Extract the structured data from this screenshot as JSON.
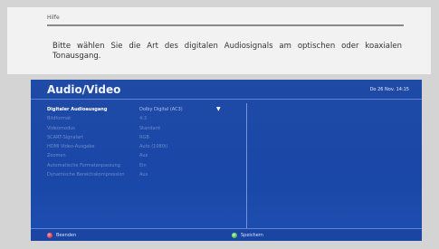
{
  "help": {
    "title": "Hilfe",
    "text": "Bitte wählen Sie die Art des digitalen Audiosignals am optischen oder koaxialen Tonausgang."
  },
  "header": {
    "title": "Audio/Video",
    "datetime": "Do 26 Nov. 14:15"
  },
  "settings": [
    {
      "label": "Digitaler Audioausgang",
      "value": "Dolby Digital (AC3)",
      "selected": true
    },
    {
      "label": "Bildformat",
      "value": "4:3"
    },
    {
      "label": "Videomodus",
      "value": "Standard"
    },
    {
      "label": "SCART-Signalart",
      "value": "RGB"
    },
    {
      "label": "HDMI Video-Ausgabe",
      "value": "Auto (1080i)"
    },
    {
      "label": "Zoomen",
      "value": "Aus"
    },
    {
      "label": "Automatische Formatanpassung",
      "value": "Ein"
    },
    {
      "label": "Dynamische Bereichskompression",
      "value": "Aus"
    }
  ],
  "footer": {
    "back_label": "Beenden",
    "save_label": "Speichern"
  },
  "colors": {
    "panel_blue": "#1a47a8",
    "red_key": "#c8102e",
    "green_key": "#1a9b1a"
  }
}
